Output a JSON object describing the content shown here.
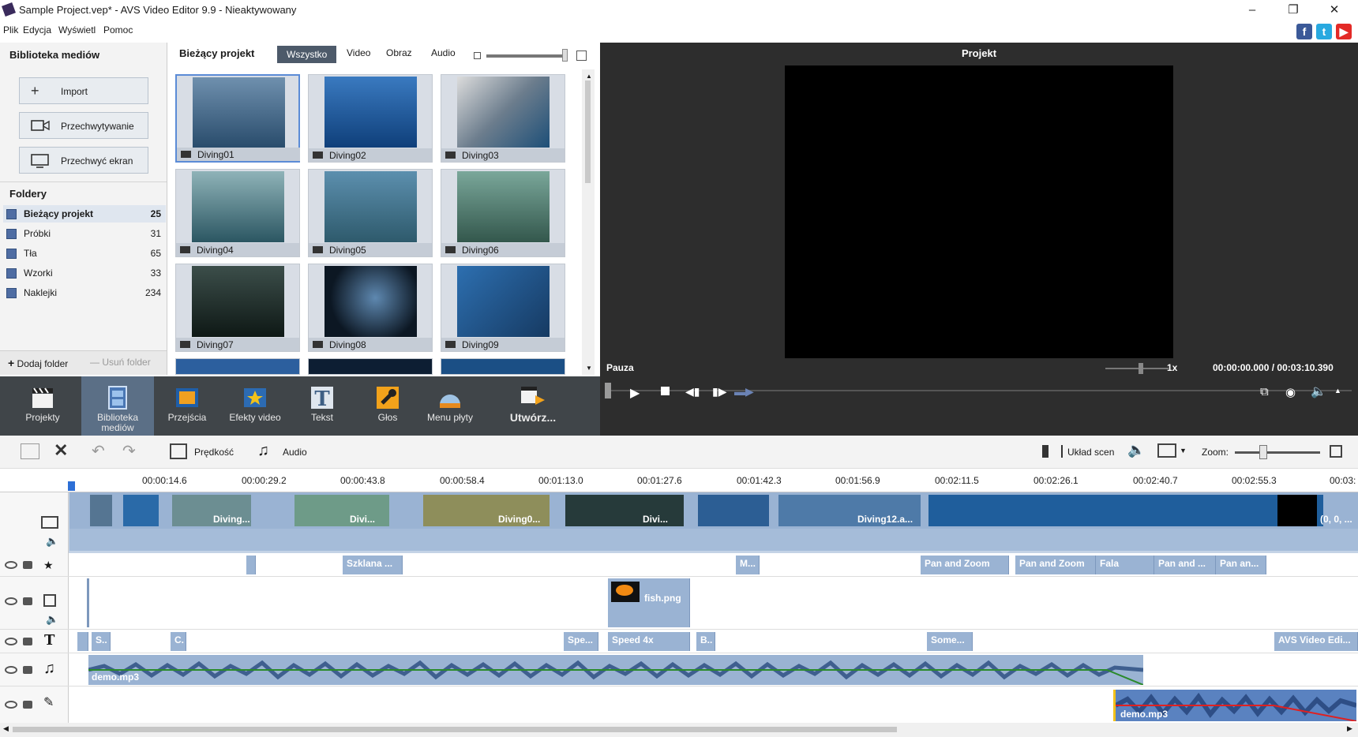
{
  "window": {
    "title": "Sample Project.vep* - AVS Video Editor 9.9 - Nieaktywowany"
  },
  "menu": [
    "Plik",
    "Edycja",
    "Wyświetl",
    "Pomoc"
  ],
  "library": {
    "title": "Biblioteka mediów",
    "buttons": [
      "Import",
      "Przechwytywanie",
      "Przechwyć ekran"
    ],
    "folders_title": "Foldery",
    "folders": [
      {
        "name": "Bieżący projekt",
        "count": "25"
      },
      {
        "name": "Próbki",
        "count": "31"
      },
      {
        "name": "Tła",
        "count": "65"
      },
      {
        "name": "Wzorki",
        "count": "33"
      },
      {
        "name": "Naklejki",
        "count": "234"
      }
    ],
    "add_folder": "Dodaj folder",
    "remove_folder": "Usuń folder"
  },
  "browser": {
    "title": "Bieżący projekt",
    "filters": [
      "Wszystko",
      "Video",
      "Obraz",
      "Audio"
    ],
    "thumbs": [
      "Diving01",
      "Diving02",
      "Diving03",
      "Diving04",
      "Diving05",
      "Diving06",
      "Diving07",
      "Diving08",
      "Diving09"
    ]
  },
  "preview": {
    "title": "Projekt",
    "status": "Pauza",
    "speed": "1x",
    "time": "00:00:00.000 / 00:03:10.390"
  },
  "toolbar": [
    "Projekty",
    "Biblioteka mediów",
    "Przejścia",
    "Efekty video",
    "Tekst",
    "Głos",
    "Menu płyty",
    "Utwórz..."
  ],
  "timeline_tools": {
    "speed": "Prędkość",
    "audio": "Audio",
    "storyboard": "Układ scen",
    "zoom": "Zoom:"
  },
  "ruler": [
    "00:00:14.6",
    "00:00:29.2",
    "00:00:43.8",
    "00:00:58.4",
    "00:01:13.0",
    "00:01:27.6",
    "00:01:42.3",
    "00:01:56.9",
    "00:02:11.5",
    "00:02:26.1",
    "00:02:40.7",
    "00:02:55.3",
    "00:03:"
  ],
  "video_captions": [
    "Diving...",
    "Divi...",
    "Diving0...",
    "Divi...",
    "Diving12.a...",
    "(0, 0, ..."
  ],
  "effects": [
    "Szklana ...",
    "M...",
    "Pan and Zoom",
    "Pan and Zoom",
    "Fala",
    "Pan and ...",
    "Pan an..."
  ],
  "overlay": {
    "label": "fish.png"
  },
  "texts": [
    "S..",
    "C.",
    "Spe...",
    "Speed 4x",
    "B..",
    "Some...",
    "AVS Video Edi..."
  ],
  "audio": {
    "music": "demo.mp3",
    "voice": "demo.mp3"
  },
  "colors": {
    "toolbar": "#404549",
    "clip": "#9ab3d3",
    "preview_bg": "#2d2d2d",
    "accent": "#4d5a6a"
  }
}
